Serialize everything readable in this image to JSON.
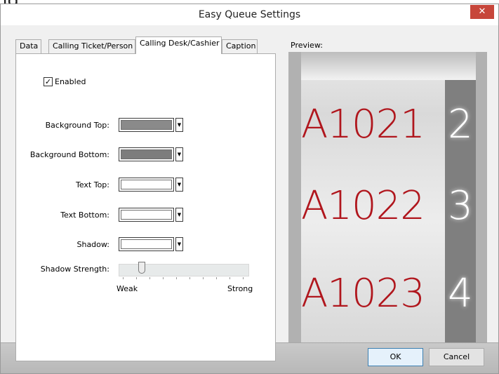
{
  "backdrop": {
    "partial_text": "ng"
  },
  "window": {
    "title": "Easy Queue Settings",
    "close_label": "✕"
  },
  "tabs": [
    {
      "label": "Data"
    },
    {
      "label": "Calling Ticket/Person"
    },
    {
      "label": "Calling Desk/Cashier",
      "active": true
    },
    {
      "label": "Caption"
    }
  ],
  "settings": {
    "enabled_label": "Enabled",
    "enabled_checked": true,
    "colors": [
      {
        "label": "Background Top:",
        "value": "#8a8a8a"
      },
      {
        "label": "Background Bottom:",
        "value": "#7d7d7d"
      },
      {
        "label": "Text Top:",
        "value": "#ffffff"
      },
      {
        "label": "Text Bottom:",
        "value": "#ffffff"
      },
      {
        "label": "Shadow:",
        "value": "#ffffff"
      }
    ],
    "shadow_strength": {
      "label": "Shadow Strength:",
      "min_label": "Weak",
      "max_label": "Strong",
      "level": 0.15
    }
  },
  "preview": {
    "label": "Preview:",
    "rows": [
      {
        "ticket": "A1021",
        "desk": "2"
      },
      {
        "ticket": "A1022",
        "desk": "3"
      },
      {
        "ticket": "A1023",
        "desk": "4"
      }
    ],
    "ticket_color": "#b0161d",
    "desk_column_color": "#7f7f7f"
  },
  "buttons": {
    "ok": "OK",
    "cancel": "Cancel"
  }
}
